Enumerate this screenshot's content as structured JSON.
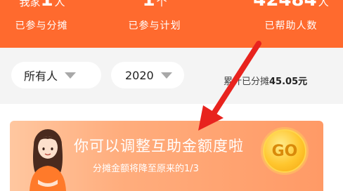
{
  "stats": [
    {
      "value": "1",
      "prefix": "我家",
      "unit": "人",
      "label": "已参与分摊"
    },
    {
      "value": "1",
      "prefix": "",
      "unit": "个",
      "label": "已参与计划"
    },
    {
      "value": "42484",
      "prefix": "",
      "unit": "人",
      "label": "已帮助人数"
    }
  ],
  "filters": {
    "person_select": "所有人",
    "year_select": "2020",
    "total_label": "累计已分摊",
    "total_amount": "45.05元"
  },
  "banner": {
    "title": "你可以调整互助金额度啦",
    "subtitle": "分摊金额将降至原来的1/3",
    "go_button": "GO"
  },
  "colors": {
    "header_bg": "#ff6a2e",
    "arrow": "#e8231e",
    "banner_start": "#ffc7a0",
    "banner_end": "#ff9a66",
    "go_gold": "#ffc62e"
  },
  "icons": [
    "dropdown-triangle-icon",
    "go-coin-icon",
    "annotation-arrow-icon"
  ]
}
